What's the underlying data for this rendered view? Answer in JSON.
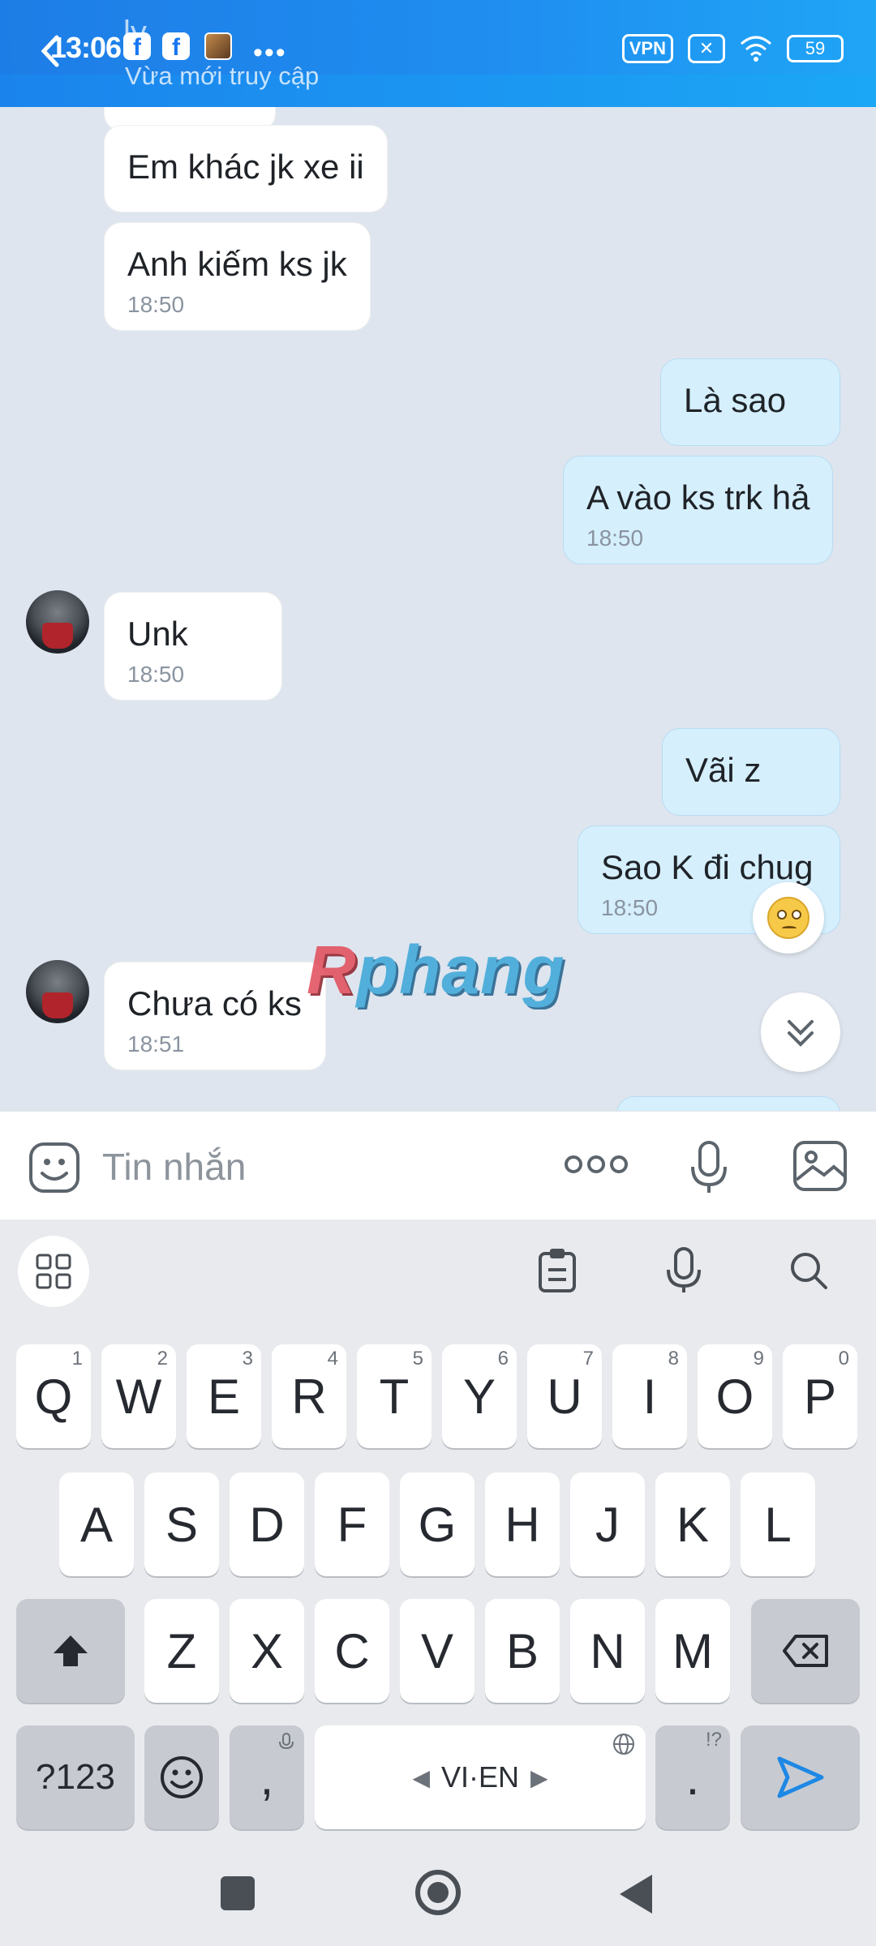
{
  "status_bar": {
    "time": "13:06",
    "fb_label": "f",
    "vpn_label": "VPN",
    "battery": "59"
  },
  "header": {
    "contact_name": "ly",
    "status": "Vừa mới truy cập"
  },
  "messages": [
    {
      "text": "Em khác jk xe ii",
      "time": ""
    },
    {
      "text": "Anh kiếm ks jk",
      "time": "18:50"
    },
    {
      "text": "Là sao",
      "time": ""
    },
    {
      "text": "A vào ks trk hả",
      "time": "18:50"
    },
    {
      "text": "Unk",
      "time": "18:50"
    },
    {
      "text": "Vãi z",
      "time": ""
    },
    {
      "text": "Sao K đi chug",
      "time": "18:50"
    },
    {
      "text": "Chưa có ks",
      "time": "18:51"
    }
  ],
  "watermark": {
    "first": "R",
    "rest": "phang"
  },
  "composer": {
    "placeholder": "Tin nhắn"
  },
  "keyboard": {
    "row1": [
      {
        "k": "Q",
        "h": "1"
      },
      {
        "k": "W",
        "h": "2"
      },
      {
        "k": "E",
        "h": "3"
      },
      {
        "k": "R",
        "h": "4"
      },
      {
        "k": "T",
        "h": "5"
      },
      {
        "k": "Y",
        "h": "6"
      },
      {
        "k": "U",
        "h": "7"
      },
      {
        "k": "I",
        "h": "8"
      },
      {
        "k": "O",
        "h": "9"
      },
      {
        "k": "P",
        "h": "0"
      }
    ],
    "row2": [
      "A",
      "S",
      "D",
      "F",
      "G",
      "H",
      "J",
      "K",
      "L"
    ],
    "row3": [
      "Z",
      "X",
      "C",
      "V",
      "B",
      "N",
      "M"
    ],
    "symbols_label": "?123",
    "comma": ",",
    "period": ".",
    "period_hint": "!?",
    "space_label": "VI·EN"
  },
  "colors": {
    "header_blue": "#1d7de6",
    "outgoing_bubble": "#d5effd",
    "incoming_bubble": "#ffffff",
    "send_blue": "#1e88e5"
  }
}
